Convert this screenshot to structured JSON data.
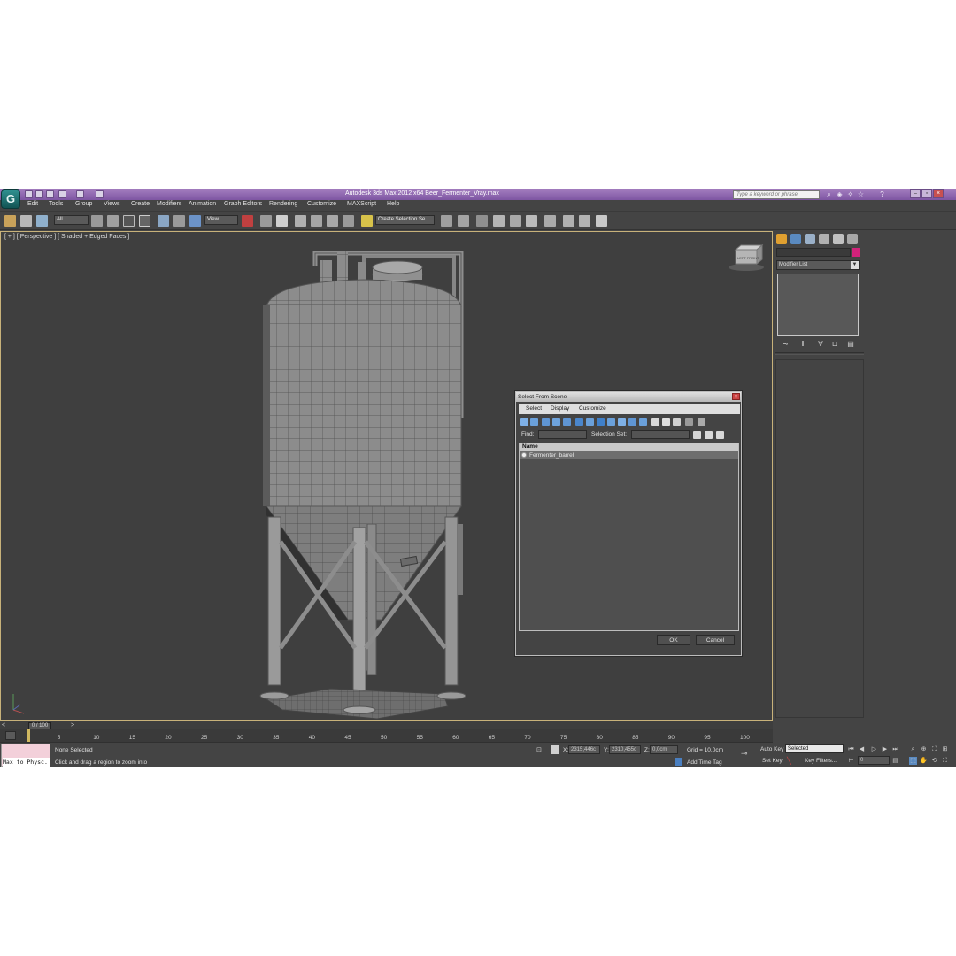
{
  "window": {
    "title": "Autodesk 3ds Max  2012 x64     Beer_Fermenter_Vray.max",
    "search_placeholder": "Type a keyword or phrase",
    "app_logo": "3ds-max-logo"
  },
  "menu": [
    "Edit",
    "Tools",
    "Group",
    "Views",
    "Create",
    "Modifiers",
    "Animation",
    "Graph Editors",
    "Rendering",
    "Customize",
    "MAXScript",
    "Help"
  ],
  "toolbar": {
    "selection_filter": "All",
    "reference_coord": "View",
    "named_selection_set": "Create Selection Se"
  },
  "viewport": {
    "label": "[ + ] [ Perspective ] [ Shaded + Edged Faces ]",
    "viewcube_label": "LEFT  FRONT"
  },
  "command_panel": {
    "modifier_list": "Modifier List",
    "object_color": "#d1227a"
  },
  "dialog": {
    "title": "Select From Scene",
    "menu": [
      "Select",
      "Display",
      "Customize"
    ],
    "find_label": "Find:",
    "selection_set_label": "Selection Set:",
    "column_header": "Name",
    "items": [
      "Fermenter_barrel"
    ],
    "ok": "OK",
    "cancel": "Cancel"
  },
  "timeline": {
    "slider_label": "0 / 100",
    "ticks": [
      "5",
      "10",
      "15",
      "20",
      "25",
      "30",
      "35",
      "40",
      "45",
      "50",
      "55",
      "60",
      "65",
      "70",
      "75",
      "80",
      "85",
      "90",
      "95",
      "100"
    ]
  },
  "status": {
    "maxscript_text": "Max to Physc.",
    "selection": "None Selected",
    "prompt": "Click and drag a region to zoom into",
    "x_label": "X:",
    "x_value": "2315,446c",
    "y_label": "Y:",
    "y_value": "2310,455c",
    "z_label": "Z:",
    "z_value": "0,0cm",
    "grid": "Grid = 10,0cm",
    "add_time_tag": "Add Time Tag",
    "auto_key": "Auto Key",
    "auto_key_mode": "Selected",
    "set_key": "Set Key",
    "key_filters": "Key Filters...",
    "current_frame": "0"
  }
}
